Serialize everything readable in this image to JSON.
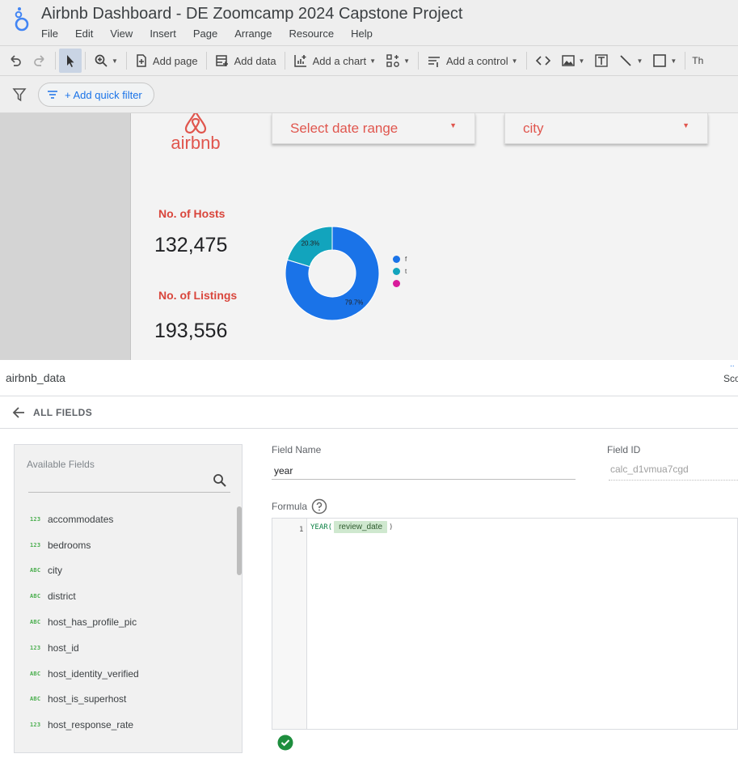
{
  "app": {
    "title": "Airbnb Dashboard - DE Zoomcamp 2024 Capstone Project",
    "menu": [
      "File",
      "Edit",
      "View",
      "Insert",
      "Page",
      "Arrange",
      "Resource",
      "Help"
    ]
  },
  "toolbar": {
    "add_page": "Add page",
    "add_data": "Add data",
    "add_chart": "Add a chart",
    "add_control": "Add a control",
    "theme_truncated": "Th"
  },
  "filterbar": {
    "quick_filter": "+ Add quick filter"
  },
  "report": {
    "logo_text": "airbnb",
    "date_dropdown": "Select date range",
    "city_dropdown": "city",
    "kpis": [
      {
        "label": "No. of Hosts",
        "value": "132,475"
      },
      {
        "label": "No. of Listings",
        "value": "193,556"
      }
    ],
    "donut": {
      "slices": [
        {
          "name": "f",
          "percent": 79.7,
          "label": "79.7%",
          "color": "#1a73e8"
        },
        {
          "name": "t",
          "percent": 20.3,
          "label": "20.3%",
          "color": "#12a4bd"
        },
        {
          "name": "",
          "percent": 0,
          "label": "",
          "color": "#d81b9b"
        }
      ]
    }
  },
  "data_panel": {
    "datasource": "airbnb_data",
    "score_truncated": "Sco",
    "back_label": "ALL FIELDS",
    "available_fields_label": "Available Fields",
    "fields": [
      {
        "type": "123",
        "name": "accommodates"
      },
      {
        "type": "123",
        "name": "bedrooms"
      },
      {
        "type": "ABC",
        "name": "city"
      },
      {
        "type": "ABC",
        "name": "district"
      },
      {
        "type": "ABC",
        "name": "host_has_profile_pic"
      },
      {
        "type": "123",
        "name": "host_id"
      },
      {
        "type": "ABC",
        "name": "host_identity_verified"
      },
      {
        "type": "ABC",
        "name": "host_is_superhost"
      },
      {
        "type": "123",
        "name": "host_response_rate"
      }
    ],
    "field_name_label": "Field Name",
    "field_name_value": "year",
    "field_id_label": "Field ID",
    "field_id_value": "calc_d1vmua7cgd",
    "formula_label": "Formula",
    "formula": {
      "line_number": "1",
      "function": "YEAR(",
      "field": "review_date",
      "close": ")"
    }
  }
}
